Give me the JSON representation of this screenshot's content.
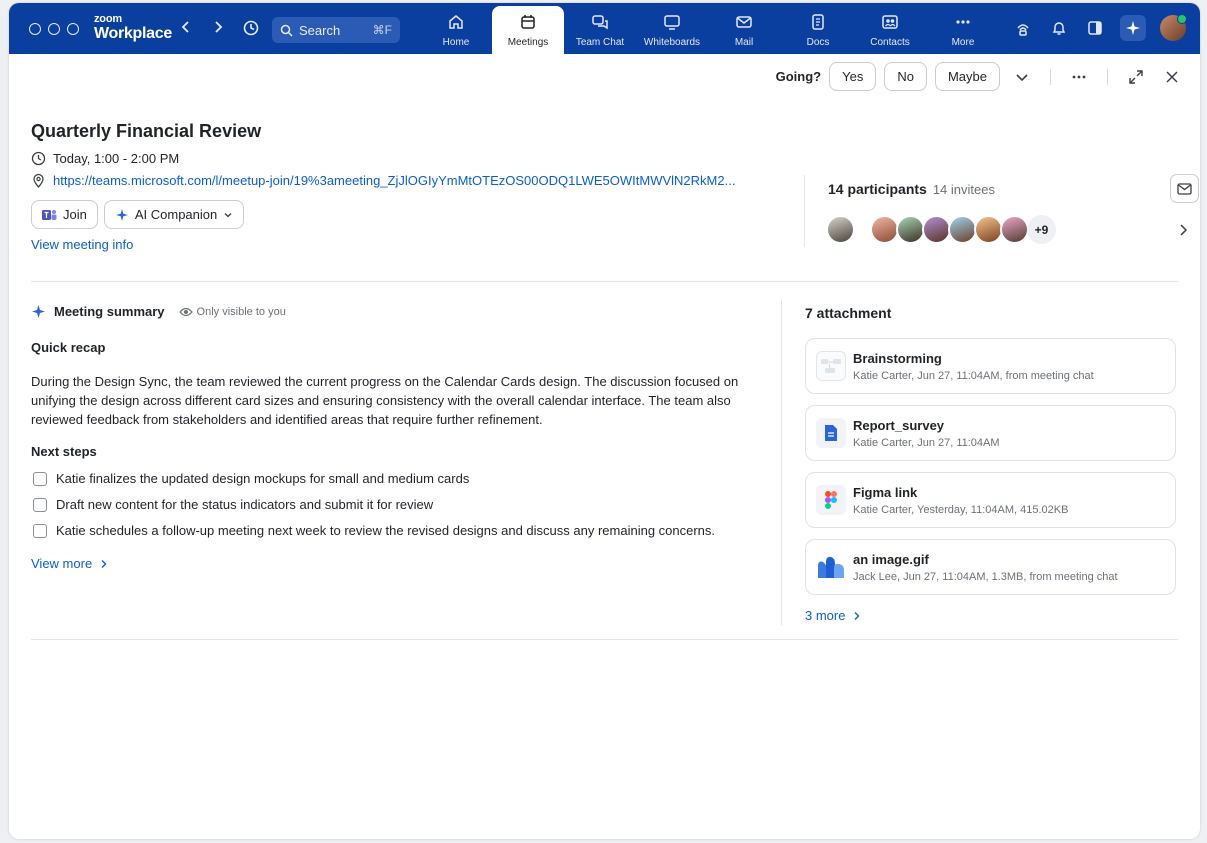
{
  "app": {
    "brand_top": "zoom",
    "brand_bottom": "Workplace"
  },
  "search": {
    "label": "Search",
    "shortcut": "⌘F"
  },
  "tabs": [
    {
      "label": "Home",
      "icon": "home-icon"
    },
    {
      "label": "Meetings",
      "icon": "calendar-icon",
      "active": true
    },
    {
      "label": "Team Chat",
      "icon": "chat-icon"
    },
    {
      "label": "Whiteboards",
      "icon": "whiteboard-icon"
    },
    {
      "label": "Mail",
      "icon": "mail-icon"
    },
    {
      "label": "Docs",
      "icon": "docs-icon"
    },
    {
      "label": "Contacts",
      "icon": "contacts-icon"
    },
    {
      "label": "More",
      "icon": "more-icon"
    }
  ],
  "rsvp": {
    "prompt": "Going?",
    "yes": "Yes",
    "no": "No",
    "maybe": "Maybe"
  },
  "meeting": {
    "title": "Quarterly Financial Review",
    "time": "Today, 1:00 - 2:00 PM",
    "link": "https://teams.microsoft.com/l/meetup-join/19%3ameeting_ZjJlOGIyYmMtOTEzOS00ODQ1LWE5OWItMWVlN2RkM2...",
    "join_label": "Join",
    "ai_label": "AI Companion",
    "view_info": "View meeting info"
  },
  "participants": {
    "title": "14 participants",
    "invitees": "14 invitees",
    "more": "+9"
  },
  "summary": {
    "title": "Meeting summary",
    "visibility": "Only visible to you",
    "recap_title": "Quick recap",
    "recap_text": "During the Design Sync, the team reviewed the current progress on the Calendar Cards design. The discussion focused on unifying the design across different card sizes and ensuring consistency with the overall calendar interface. The team also reviewed feedback from stakeholders and identified areas that require further refinement.",
    "next_title": "Next steps",
    "tasks": [
      "Katie finalizes the updated design mockups for small and medium cards",
      "Draft new content for the status indicators and submit it for review",
      "Katie schedules a follow-up meeting next week to review the revised designs and discuss any remaining concerns."
    ],
    "view_more": "View more"
  },
  "attachments": {
    "title": "7 attachment",
    "items": [
      {
        "name": "Brainstorming",
        "meta": "Katie Carter, Jun 27, 11:04AM, from meeting chat",
        "icon": "whiteboard-thumbnail-icon"
      },
      {
        "name": "Report_survey",
        "meta": "Katie Carter, Jun 27, 11:04AM",
        "icon": "doc-file-icon"
      },
      {
        "name": "Figma link",
        "meta": "Katie Carter, Yesterday, 11:04AM, 415.02KB",
        "icon": "figma-icon"
      },
      {
        "name": "an image.gif",
        "meta": "Jack Lee, Jun 27, 11:04AM, 1.3MB, from meeting chat",
        "icon": "image-icon"
      }
    ],
    "more": "3 more"
  },
  "colors": {
    "topbar": "#0b3f9f",
    "link": "#0b5cd6",
    "accent": "#2c5bb5"
  }
}
